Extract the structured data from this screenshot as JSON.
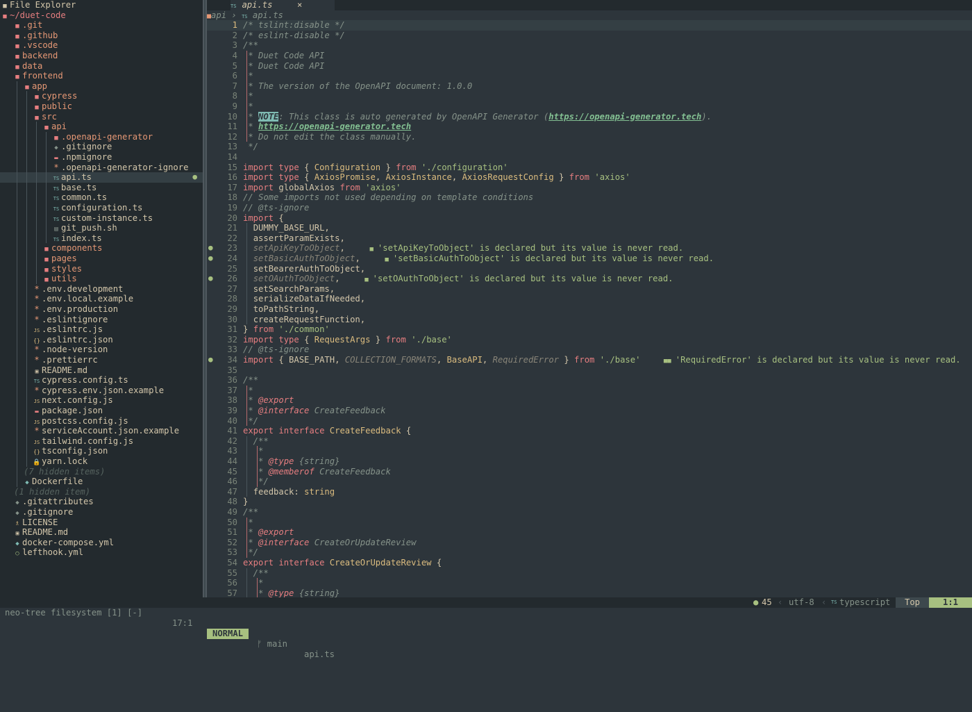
{
  "explorer": {
    "title": "File Explorer",
    "root": "~/duet-code",
    "items": [
      {
        "label": ".git",
        "icon": "folder-icon"
      },
      {
        "label": ".github",
        "icon": "folder-icon"
      },
      {
        "label": ".vscode",
        "icon": "folder-icon"
      },
      {
        "label": "backend",
        "icon": "folder-icon"
      },
      {
        "label": "data",
        "icon": "folder-icon"
      },
      {
        "label": "frontend",
        "icon": "folder-open-icon"
      },
      {
        "label": "app",
        "icon": "folder-open-icon"
      },
      {
        "label": "cypress",
        "icon": "folder-icon"
      },
      {
        "label": "public",
        "icon": "folder-icon"
      },
      {
        "label": "src",
        "icon": "folder-open-icon"
      },
      {
        "label": "api",
        "icon": "folder-open-icon"
      },
      {
        "label": ".openapi-generator",
        "icon": "folder-icon"
      },
      {
        "label": ".gitignore",
        "icon": "git-icon"
      },
      {
        "label": ".npmignore",
        "icon": "npm-icon"
      },
      {
        "label": ".openapi-generator-ignore",
        "icon": "config-icon"
      },
      {
        "label": "api.ts",
        "icon": "typescript-icon"
      },
      {
        "label": "base.ts",
        "icon": "typescript-icon"
      },
      {
        "label": "common.ts",
        "icon": "typescript-icon"
      },
      {
        "label": "configuration.ts",
        "icon": "typescript-icon"
      },
      {
        "label": "custom-instance.ts",
        "icon": "typescript-icon"
      },
      {
        "label": "git_push.sh",
        "icon": "shell-icon"
      },
      {
        "label": "index.ts",
        "icon": "typescript-icon"
      },
      {
        "label": "components",
        "icon": "folder-icon"
      },
      {
        "label": "pages",
        "icon": "folder-icon"
      },
      {
        "label": "styles",
        "icon": "folder-icon"
      },
      {
        "label": "utils",
        "icon": "folder-icon"
      },
      {
        "label": ".env.development",
        "icon": "config-icon"
      },
      {
        "label": ".env.local.example",
        "icon": "config-icon"
      },
      {
        "label": ".env.production",
        "icon": "config-icon"
      },
      {
        "label": ".eslintignore",
        "icon": "config-icon"
      },
      {
        "label": ".eslintrc.js",
        "icon": "javascript-icon"
      },
      {
        "label": ".eslintrc.json",
        "icon": "json-icon"
      },
      {
        "label": ".node-version",
        "icon": "config-icon"
      },
      {
        "label": ".prettierrc",
        "icon": "config-icon"
      },
      {
        "label": "README.md",
        "icon": "markdown-icon"
      },
      {
        "label": "cypress.config.ts",
        "icon": "typescript-icon"
      },
      {
        "label": "cypress.env.json.example",
        "icon": "config-icon"
      },
      {
        "label": "next.config.js",
        "icon": "javascript-icon"
      },
      {
        "label": "package.json",
        "icon": "npm-icon"
      },
      {
        "label": "postcss.config.js",
        "icon": "javascript-icon"
      },
      {
        "label": "serviceAccount.json.example",
        "icon": "config-icon"
      },
      {
        "label": "tailwind.config.js",
        "icon": "javascript-icon"
      },
      {
        "label": "tsconfig.json",
        "icon": "json-icon"
      },
      {
        "label": "yarn.lock",
        "icon": "lock-icon"
      },
      {
        "label": "(7 hidden items)",
        "icon": ""
      },
      {
        "label": "Dockerfile",
        "icon": "docker-icon"
      },
      {
        "label": "(1 hidden item)",
        "icon": ""
      },
      {
        "label": ".gitattributes",
        "icon": "git-icon"
      },
      {
        "label": ".gitignore",
        "icon": "git-icon"
      },
      {
        "label": "LICENSE",
        "icon": "license-icon"
      },
      {
        "label": "README.md",
        "icon": "markdown-icon"
      },
      {
        "label": "docker-compose.yml",
        "icon": "docker-icon"
      },
      {
        "label": "lefthook.yml",
        "icon": "hook-icon"
      }
    ]
  },
  "tab": {
    "label": "api.ts",
    "close": "×"
  },
  "breadcrumb": {
    "folder": "api",
    "sep": "›",
    "file": "api.ts"
  },
  "code": {
    "lines": [
      "/* tslint:disable */",
      "/* eslint-disable */",
      "/**",
      " * Duet Code API",
      " * Duet Code API",
      " *",
      " * The version of the OpenAPI document: 1.0.0",
      " *",
      " *",
      " * NOTE: This class is auto generated by OpenAPI Generator (https://openapi-generator.tech).",
      " * https://openapi-generator.tech",
      " * Do not edit the class manually.",
      " */",
      "",
      "import type { Configuration } from './configuration'",
      "import type { AxiosPromise, AxiosInstance, AxiosRequestConfig } from 'axios'",
      "import globalAxios from 'axios'",
      "// Some imports not used depending on template conditions",
      "// @ts-ignore",
      "import {",
      "  DUMMY_BASE_URL,",
      "  assertParamExists,",
      "  setApiKeyToObject,",
      "  setBasicAuthToObject,",
      "  setBearerAuthToObject,",
      "  setOAuthToObject,",
      "  setSearchParams,",
      "  serializeDataIfNeeded,",
      "  toPathString,",
      "  createRequestFunction,",
      "} from './common'",
      "import type { RequestArgs } from './base'",
      "// @ts-ignore",
      "import { BASE_PATH, COLLECTION_FORMATS, BaseAPI, RequiredError } from './base'",
      "",
      "/**",
      " *",
      " * @export",
      " * @interface CreateFeedback",
      " */",
      "export interface CreateFeedback {",
      "  /**",
      "   *",
      "   * @type {string}",
      "   * @memberof CreateFeedback",
      "   */",
      "  feedback: string",
      "}",
      "/**",
      " *",
      " * @export",
      " * @interface CreateOrUpdateReview",
      " */",
      "export interface CreateOrUpdateReview {",
      "  /**",
      "   *",
      "   * @type {string}"
    ],
    "diagnostics": [
      {
        "line": 23,
        "message": "'setApiKeyToObject' is declared but its value is never read."
      },
      {
        "line": 24,
        "message": "'setBasicAuthToObject' is declared but its value is never read."
      },
      {
        "line": 26,
        "message": "'setOAuthToObject' is declared but its value is never read."
      },
      {
        "line": 34,
        "message": "'RequiredError' is declared but its value is never read."
      }
    ]
  },
  "statusline": {
    "left": "neo-tree filesystem [1] [-]",
    "left_position": "17:1",
    "mode": "NORMAL",
    "branch_icon": "ᚠ",
    "branch": "main",
    "file": "api.ts",
    "diagnostic_count": "45",
    "encoding": "utf-8",
    "filetype": "typescript",
    "scroll": "Top",
    "position": "1:1"
  },
  "colors": {
    "background": "#2d353b",
    "sidebar": "#232a2e",
    "accent": "#a7c080",
    "keyword": "#e67e80",
    "string": "#a7c080",
    "type": "#dbbc7f",
    "comment": "#859289"
  }
}
